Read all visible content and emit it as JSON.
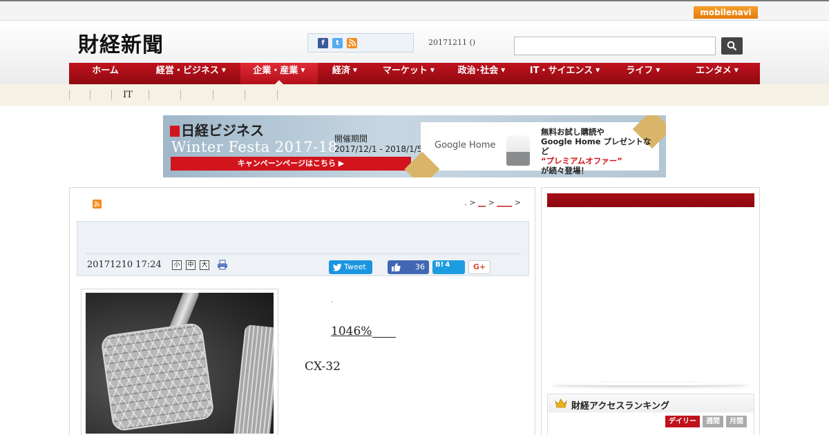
{
  "topbar": {
    "mobile_logo": "mobilenavi"
  },
  "header": {
    "site_title": "財経新聞",
    "date": "20171211 ()",
    "search_placeholder": ""
  },
  "nav": {
    "items": [
      {
        "label": "ホーム",
        "caret": ""
      },
      {
        "label": "経営・ビジネス",
        "caret": "▼"
      },
      {
        "label": "企業・産業",
        "caret": "▼"
      },
      {
        "label": "経済",
        "caret": "▼"
      },
      {
        "label": "マーケット",
        "caret": "▼"
      },
      {
        "label": "政治･社会",
        "caret": "▼"
      },
      {
        "label": "IT・サイエンス",
        "caret": "▼"
      },
      {
        "label": "ライフ",
        "caret": "▼"
      },
      {
        "label": "エンタメ",
        "caret": "▼"
      }
    ],
    "active_index": 2
  },
  "subnav": {
    "visible_label": "IT"
  },
  "banner": {
    "nikkei": "日経ビジネス",
    "festa": "Winter Festa 2017-18",
    "period_label": "開催期間",
    "period_dates": "2017/12/1 - 2018/1/5",
    "cta": "キャンペーンページはこちら ▶",
    "google_home": "Google Home",
    "promo_line1": "無料お試し購読や",
    "promo_line2": "Google Home プレゼントなど",
    "promo_line3": "“プレミアムオファー”",
    "promo_line4": "が続々登場！"
  },
  "article": {
    "breadcrumb_start": ". >",
    "breadcrumb_link1": "__",
    "breadcrumb_sep": ">",
    "breadcrumb_link2": "____",
    "breadcrumb_end": ">",
    "datetime": "20171210 17:24",
    "font_small": "小",
    "font_medium": "中",
    "font_large": "大",
    "tweet_label": "Tweet",
    "like_count": "36",
    "hatena_label": "B!",
    "hatena_count": "4",
    "gplus_label": "G+",
    "text_dot": ".",
    "text_number": "1046%",
    "text_model": "CX-32"
  },
  "sidebar": {
    "ranking_title": "財経アクセスランキング",
    "tabs": [
      "デイリー",
      "週間",
      "月間"
    ]
  },
  "colors": {
    "nav_red": "#c0121d",
    "nav_active": "#e02a35",
    "accent_orange": "#f48a1f",
    "twitter": "#1b95e0",
    "facebook": "#4267b2"
  }
}
